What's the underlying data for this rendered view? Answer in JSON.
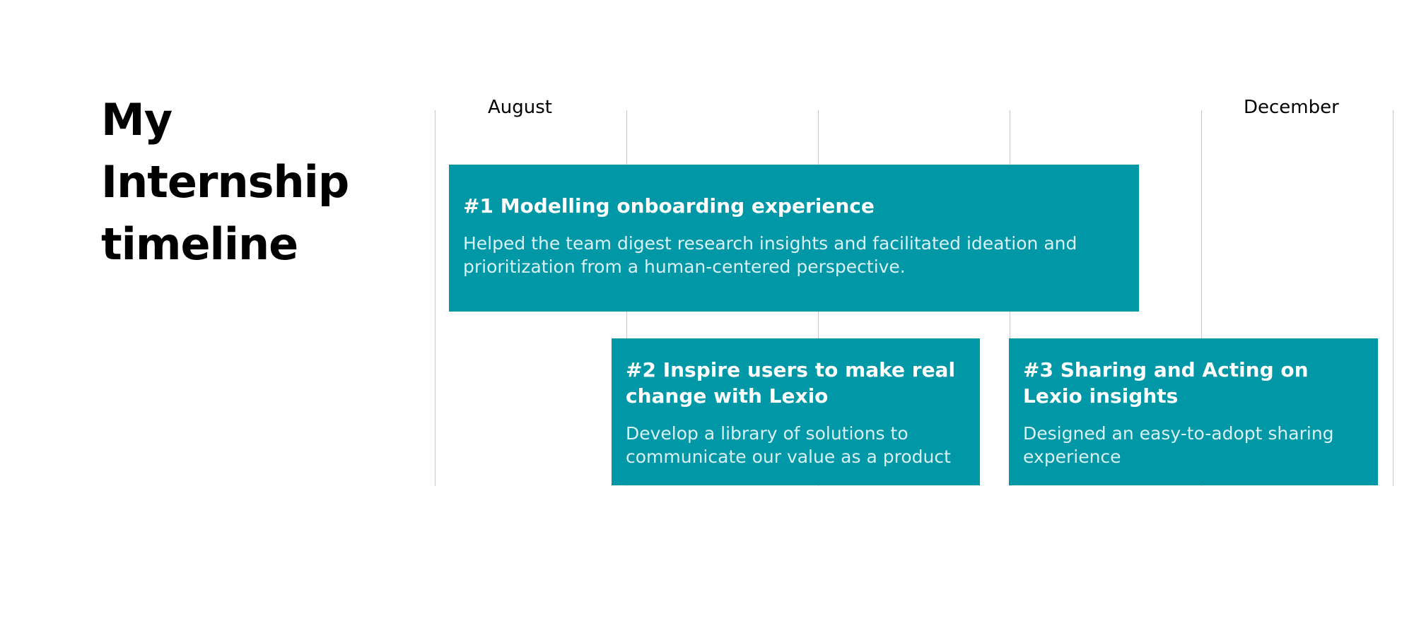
{
  "page": {
    "title": "My Internship timeline"
  },
  "timeline": {
    "months": [
      {
        "name": "August",
        "column": 0
      },
      {
        "name": "December",
        "column": 4
      }
    ],
    "column_count": 5,
    "card_color": "#0097a7",
    "desc_color": "#d9f1f4",
    "grid_color": "#c8c8c8",
    "tasks": [
      {
        "title": "#1 Modelling onboarding experience",
        "description": "Helped the team digest research insights and facilitated ideation and prioritization from a human-centered perspective.",
        "row": 0
      },
      {
        "title": "#2 Inspire users to make real change with Lexio",
        "description": "Develop a library of solutions to communicate our value as a product",
        "row": 1
      },
      {
        "title": "#3 Sharing and Acting on Lexio insights",
        "description": "Designed an easy-to-adopt sharing experience",
        "row": 1
      }
    ]
  }
}
